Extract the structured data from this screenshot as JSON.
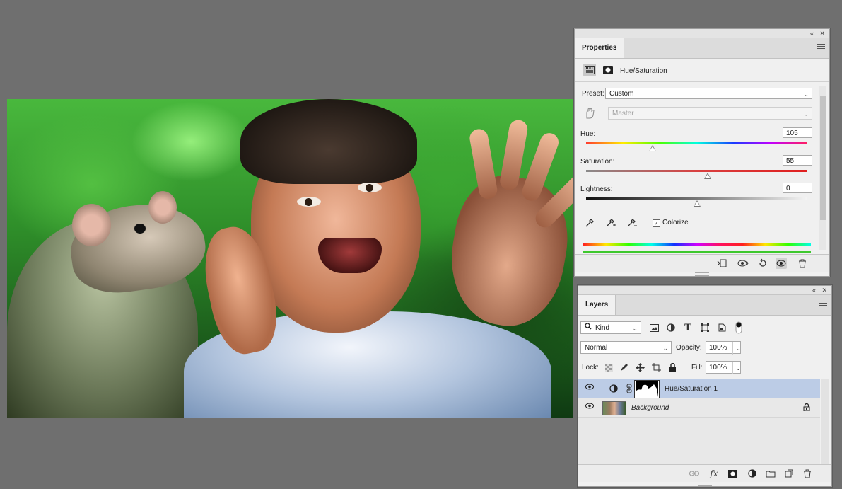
{
  "properties": {
    "tab_label": "Properties",
    "adjustment_title": "Hue/Saturation",
    "preset_label": "Preset:",
    "preset_value": "Custom",
    "channel_value": "Master",
    "hue": {
      "label": "Hue:",
      "value": "105"
    },
    "saturation": {
      "label": "Saturation:",
      "value": "55"
    },
    "lightness": {
      "label": "Lightness:",
      "value": "0"
    },
    "colorize_label": "Colorize",
    "colorize_checked": true,
    "slider_fraction": {
      "hue": 0.3,
      "saturation": 0.55,
      "lightness": 0.5
    }
  },
  "layers": {
    "tab_label": "Layers",
    "filter_kind": "Kind",
    "blend_mode": "Normal",
    "opacity_label": "Opacity:",
    "opacity_value": "100%",
    "lock_label": "Lock:",
    "fill_label": "Fill:",
    "fill_value": "100%",
    "items": [
      {
        "name": "Hue/Saturation 1",
        "selected": true
      },
      {
        "name": "Background",
        "selected": false,
        "locked": true
      }
    ]
  },
  "icons": {
    "collapse": "«",
    "close": "✕",
    "caret": "⌄",
    "eye": "👁",
    "text_tool": "T",
    "fx": "fx",
    "trash": "🗑"
  },
  "colors": {
    "selected_layer": "#bccce6",
    "panel_bg": "#f0f0f0",
    "workspace": "#6f6f6f"
  }
}
